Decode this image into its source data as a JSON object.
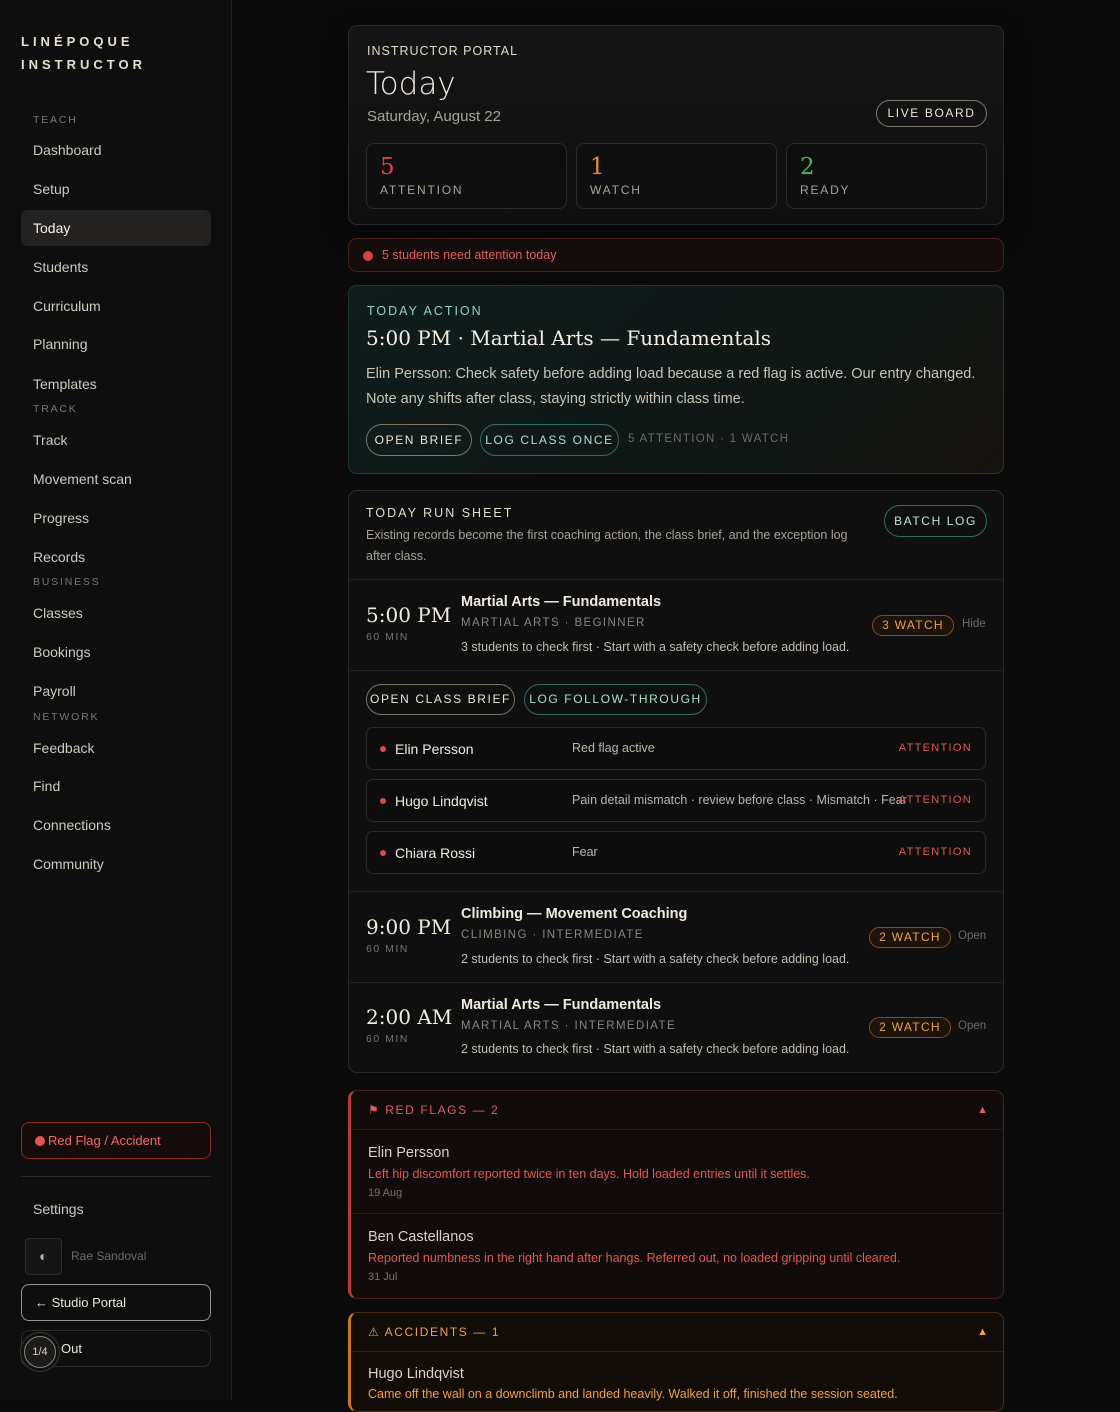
{
  "brand": {
    "line1": "LINÉPOQUE",
    "line2": "INSTRUCTOR"
  },
  "sidebar": {
    "sections": [
      {
        "label": "TEACH",
        "items": [
          "Dashboard",
          "Setup",
          "Today",
          "Students",
          "Curriculum",
          "Planning",
          "Templates"
        ]
      },
      {
        "label": "TRACK",
        "items": [
          "Track",
          "Movement scan",
          "Progress",
          "Records"
        ]
      },
      {
        "label": "BUSINESS",
        "items": [
          "Classes",
          "Bookings",
          "Payroll"
        ]
      },
      {
        "label": "NETWORK",
        "items": [
          "Feedback",
          "Find",
          "Connections",
          "Community"
        ]
      }
    ],
    "active": "Today",
    "red_flag_button": "Red Flag / Accident",
    "settings": "Settings",
    "user_icon": "◐",
    "user_name": "Rae Sandoval",
    "studio_portal": "← Studio Portal",
    "sign_out": "Out",
    "pager": "1/4"
  },
  "hero": {
    "kicker": "INSTRUCTOR PORTAL",
    "title": "Today",
    "date": "Saturday, August 22",
    "live_board": "LIVE BOARD",
    "stats": [
      {
        "value": "5",
        "label": "ATTENTION",
        "color": "#e0473f"
      },
      {
        "value": "1",
        "label": "WATCH",
        "color": "#ea8a33"
      },
      {
        "value": "2",
        "label": "READY",
        "color": "#4fb35a"
      }
    ]
  },
  "alert": {
    "text": "5 students need attention today"
  },
  "today_action": {
    "kicker": "TODAY ACTION",
    "title": "5:00 PM · Martial Arts — Fundamentals",
    "body": "Elin Persson: Check safety before adding load because a red flag is active. Our entry changed. Note any shifts after class, staying strictly within class time.",
    "open_brief": "OPEN BRIEF",
    "log_once": "LOG CLASS ONCE",
    "meta": "5 ATTENTION · 1 WATCH"
  },
  "run_sheet": {
    "kicker": "TODAY RUN SHEET",
    "description": "Existing records become the first coaching action, the class brief, and the exception log after class.",
    "batch_log": "BATCH LOG",
    "classes": [
      {
        "time": "5:00 PM",
        "duration": "60 MIN",
        "name": "Martial Arts — Fundamentals",
        "sub": "MARTIAL ARTS · BEGINNER",
        "info": "3 students to check first · Start with a safety check before adding load.",
        "badge": "3 WATCH",
        "toggle": "Hide"
      },
      {
        "time": "9:00 PM",
        "duration": "60 MIN",
        "name": "Climbing — Movement Coaching",
        "sub": "CLIMBING · INTERMEDIATE",
        "info": "2 students to check first · Start with a safety check before adding load.",
        "badge": "2 WATCH",
        "toggle": "Open"
      },
      {
        "time": "2:00 AM",
        "duration": "60 MIN",
        "name": "Martial Arts — Fundamentals",
        "sub": "MARTIAL ARTS · INTERMEDIATE",
        "info": "2 students to check first · Start with a safety check before adding load.",
        "badge": "2 WATCH",
        "toggle": "Open"
      }
    ],
    "open_class_brief": "OPEN CLASS BRIEF",
    "log_follow": "LOG FOLLOW-THROUGH",
    "students": [
      {
        "name": "Elin Persson",
        "reason": "Red flag active",
        "status": "ATTENTION"
      },
      {
        "name": "Hugo Lindqvist",
        "reason": "Pain detail mismatch · review before class · Mismatch · Fear",
        "status": "ATTENTION"
      },
      {
        "name": "Chiara Rossi",
        "reason": "Fear",
        "status": "ATTENTION"
      }
    ]
  },
  "red_flags": {
    "header": "⚑  RED FLAGS — 2",
    "toggle_icon": "▲",
    "entries": [
      {
        "name": "Elin Persson",
        "text": "Left hip discomfort reported twice in ten days. Hold loaded entries until it settles.",
        "date": "19 Aug"
      },
      {
        "name": "Ben Castellanos",
        "text": "Reported numbness in the right hand after hangs. Referred out, no loaded gripping until cleared.",
        "date": "31 Jul"
      }
    ]
  },
  "accidents": {
    "header": "⚠  ACCIDENTS — 1",
    "toggle_icon": "▲",
    "entries": [
      {
        "name": "Hugo Lindqvist",
        "text": "Came off the wall on a downclimb and landed heavily. Walked it off, finished the session seated."
      }
    ]
  }
}
